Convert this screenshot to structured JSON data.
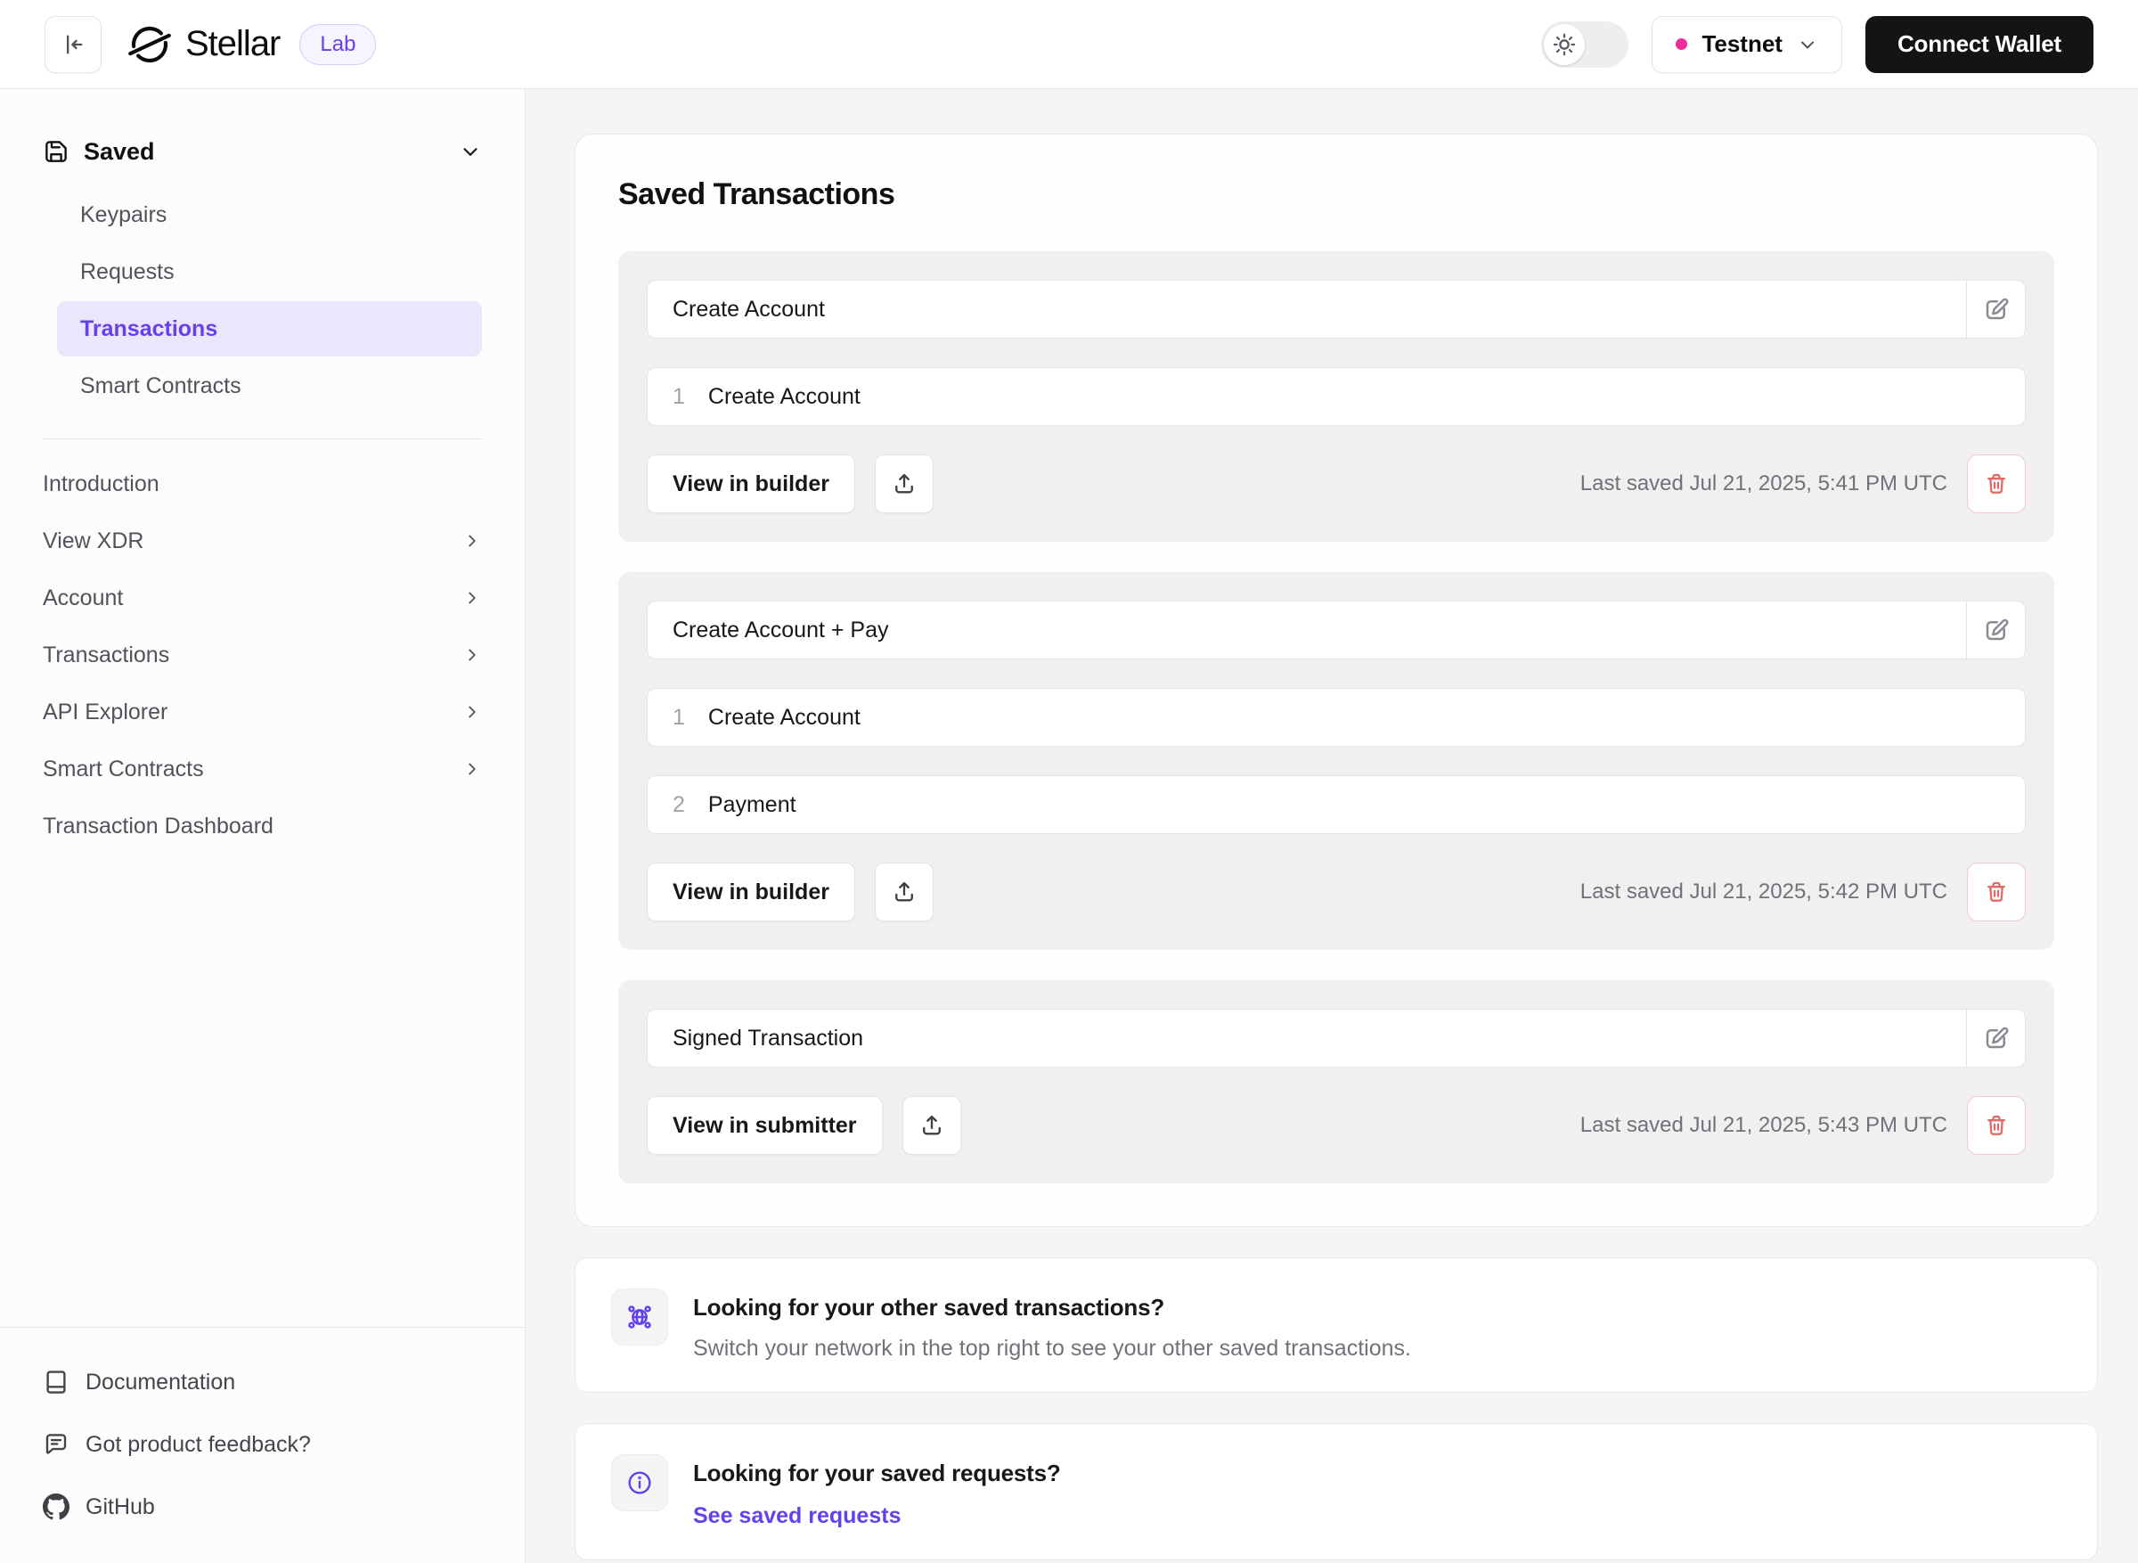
{
  "header": {
    "brand": "Stellar",
    "badge": "Lab",
    "network_label": "Testnet",
    "connect_wallet_label": "Connect Wallet"
  },
  "sidebar": {
    "saved": {
      "label": "Saved",
      "items": [
        {
          "label": "Keypairs",
          "active": false
        },
        {
          "label": "Requests",
          "active": false
        },
        {
          "label": "Transactions",
          "active": true
        },
        {
          "label": "Smart Contracts",
          "active": false
        }
      ]
    },
    "nav": [
      {
        "label": "Introduction",
        "has_submenu": false
      },
      {
        "label": "View XDR",
        "has_submenu": true
      },
      {
        "label": "Account",
        "has_submenu": true
      },
      {
        "label": "Transactions",
        "has_submenu": true
      },
      {
        "label": "API Explorer",
        "has_submenu": true
      },
      {
        "label": "Smart Contracts",
        "has_submenu": true
      },
      {
        "label": "Transaction Dashboard",
        "has_submenu": false
      }
    ],
    "footer": [
      {
        "label": "Documentation",
        "icon": "book-icon"
      },
      {
        "label": "Got product feedback?",
        "icon": "feedback-bubble-icon"
      },
      {
        "label": "GitHub",
        "icon": "github-icon"
      }
    ]
  },
  "main": {
    "title": "Saved Transactions",
    "transactions": [
      {
        "name": "Create Account",
        "operations": [
          {
            "number": "1",
            "label": "Create Account"
          }
        ],
        "action_label": "View in builder",
        "last_saved": "Last saved Jul 21, 2025, 5:41 PM UTC"
      },
      {
        "name": "Create Account + Pay",
        "operations": [
          {
            "number": "1",
            "label": "Create Account"
          },
          {
            "number": "2",
            "label": "Payment"
          }
        ],
        "action_label": "View in builder",
        "last_saved": "Last saved Jul 21, 2025, 5:42 PM UTC"
      },
      {
        "name": "Signed Transaction",
        "operations": [],
        "action_label": "View in submitter",
        "last_saved": "Last saved Jul 21, 2025, 5:43 PM UTC"
      }
    ],
    "info_boxes": [
      {
        "icon": "network-globe-icon",
        "title": "Looking for your other saved transactions?",
        "description": "Switch your network in the top right to see your other saved transactions."
      },
      {
        "icon": "info-icon",
        "title": "Looking for your saved requests?",
        "link_label": "See saved requests"
      }
    ]
  },
  "icons": {
    "collapse-sidebar-icon": "arrow to left bar",
    "stellar-logo-icon": "broken circle with diagonal slash",
    "save-icon": "floppy disk",
    "chevron-down-icon": "v",
    "chevron-right-icon": ">",
    "sun-icon": "light theme sun",
    "edit-icon": "square with pen",
    "upload-icon": "arrow up from tray",
    "trash-icon": "trash can",
    "book-icon": "closed book",
    "feedback-bubble-icon": "speech bubble with lines",
    "github-icon": "github mark",
    "network-globe-icon": "globe with corner nodes",
    "info-icon": "i in circle"
  },
  "theme": {
    "accent": "#6342ec",
    "accent_bg": "#ece6fc",
    "network_dot": "#f02b9d",
    "delete": "#e06969",
    "delete_border": "#f5c9c9"
  }
}
